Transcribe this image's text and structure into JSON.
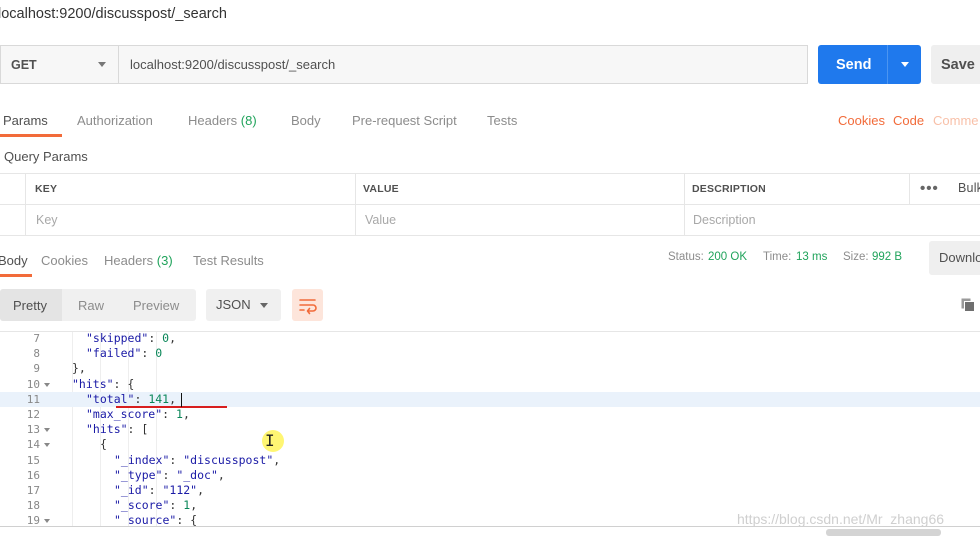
{
  "request": {
    "title": "localhost:9200/discusspost/_search",
    "method": "GET",
    "url": "localhost:9200/discusspost/_search",
    "send_label": "Send",
    "save_label": "Save"
  },
  "request_tabs": {
    "params": "Params",
    "authorization": "Authorization",
    "headers": "Headers",
    "headers_count": "(8)",
    "body": "Body",
    "prerequest": "Pre-request Script",
    "tests": "Tests",
    "cookies": "Cookies",
    "code": "Code",
    "comments": "Comme"
  },
  "query_params": {
    "title": "Query Params",
    "col_key": "KEY",
    "col_value": "VALUE",
    "col_description": "DESCRIPTION",
    "bulk": "Bulk",
    "key_placeholder": "Key",
    "value_placeholder": "Value",
    "description_placeholder": "Description"
  },
  "response_tabs": {
    "body": "Body",
    "cookies": "Cookies",
    "headers": "Headers",
    "headers_count": "(3)",
    "test_results": "Test Results",
    "status_label": "Status:",
    "status_value": "200 OK",
    "time_label": "Time:",
    "time_value": "13 ms",
    "size_label": "Size:",
    "size_value": "992 B",
    "download": "Downlo"
  },
  "view": {
    "pretty": "Pretty",
    "raw": "Raw",
    "preview": "Preview",
    "format": "JSON"
  },
  "code_lines": [
    {
      "n": "7",
      "fold": false,
      "indent": 4,
      "parts": [
        [
          "s",
          "\"skipped\""
        ],
        [
          "p",
          ": "
        ],
        [
          "n",
          "0"
        ],
        [
          "p",
          ","
        ]
      ]
    },
    {
      "n": "8",
      "fold": false,
      "indent": 4,
      "parts": [
        [
          "s",
          "\"failed\""
        ],
        [
          "p",
          ": "
        ],
        [
          "n",
          "0"
        ]
      ]
    },
    {
      "n": "9",
      "fold": false,
      "indent": 2,
      "parts": [
        [
          "p",
          "},"
        ]
      ]
    },
    {
      "n": "10",
      "fold": true,
      "indent": 2,
      "parts": [
        [
          "s",
          "\"hits\""
        ],
        [
          "p",
          ": {"
        ]
      ]
    },
    {
      "n": "11",
      "fold": false,
      "indent": 4,
      "hl": true,
      "parts": [
        [
          "s",
          "\"total\""
        ],
        [
          "p",
          ": "
        ],
        [
          "n",
          "141"
        ],
        [
          "p",
          ","
        ]
      ]
    },
    {
      "n": "12",
      "fold": false,
      "indent": 4,
      "parts": [
        [
          "s",
          "\"max_score\""
        ],
        [
          "p",
          ": "
        ],
        [
          "n",
          "1"
        ],
        [
          "p",
          ","
        ]
      ]
    },
    {
      "n": "13",
      "fold": true,
      "indent": 4,
      "parts": [
        [
          "s",
          "\"hits\""
        ],
        [
          "p",
          ": ["
        ]
      ]
    },
    {
      "n": "14",
      "fold": true,
      "indent": 6,
      "parts": [
        [
          "p",
          "{"
        ]
      ]
    },
    {
      "n": "15",
      "fold": false,
      "indent": 8,
      "parts": [
        [
          "s",
          "\"_index\""
        ],
        [
          "p",
          ": "
        ],
        [
          "s",
          "\"discusspost\""
        ],
        [
          "p",
          ","
        ]
      ]
    },
    {
      "n": "16",
      "fold": false,
      "indent": 8,
      "parts": [
        [
          "s",
          "\"_type\""
        ],
        [
          "p",
          ": "
        ],
        [
          "s",
          "\"_doc\""
        ],
        [
          "p",
          ","
        ]
      ]
    },
    {
      "n": "17",
      "fold": false,
      "indent": 8,
      "parts": [
        [
          "s",
          "\"_id\""
        ],
        [
          "p",
          ": "
        ],
        [
          "s",
          "\"112\""
        ],
        [
          "p",
          ","
        ]
      ]
    },
    {
      "n": "18",
      "fold": false,
      "indent": 8,
      "parts": [
        [
          "s",
          "\"_score\""
        ],
        [
          "p",
          ": "
        ],
        [
          "n",
          "1"
        ],
        [
          "p",
          ","
        ]
      ]
    },
    {
      "n": "19",
      "fold": true,
      "indent": 8,
      "parts": [
        [
          "s",
          "\"_source\""
        ],
        [
          "p",
          ": {"
        ]
      ]
    }
  ],
  "watermark": "https://blog.csdn.net/Mr_zhang66",
  "colors": {
    "accent": "#f26b3a",
    "send": "#1f79ed",
    "status_ok": "#20a35b",
    "json_string": "#1a1aa6",
    "json_number": "#098658"
  },
  "icons": {
    "method_dropdown": "chevron-down-icon",
    "send_dropdown": "chevron-down-icon",
    "more": "ellipsis-icon",
    "wrap": "wrap-lines-icon",
    "copy": "copy-icon",
    "fold": "fold-arrow-icon",
    "cursor": "text-cursor-icon"
  }
}
